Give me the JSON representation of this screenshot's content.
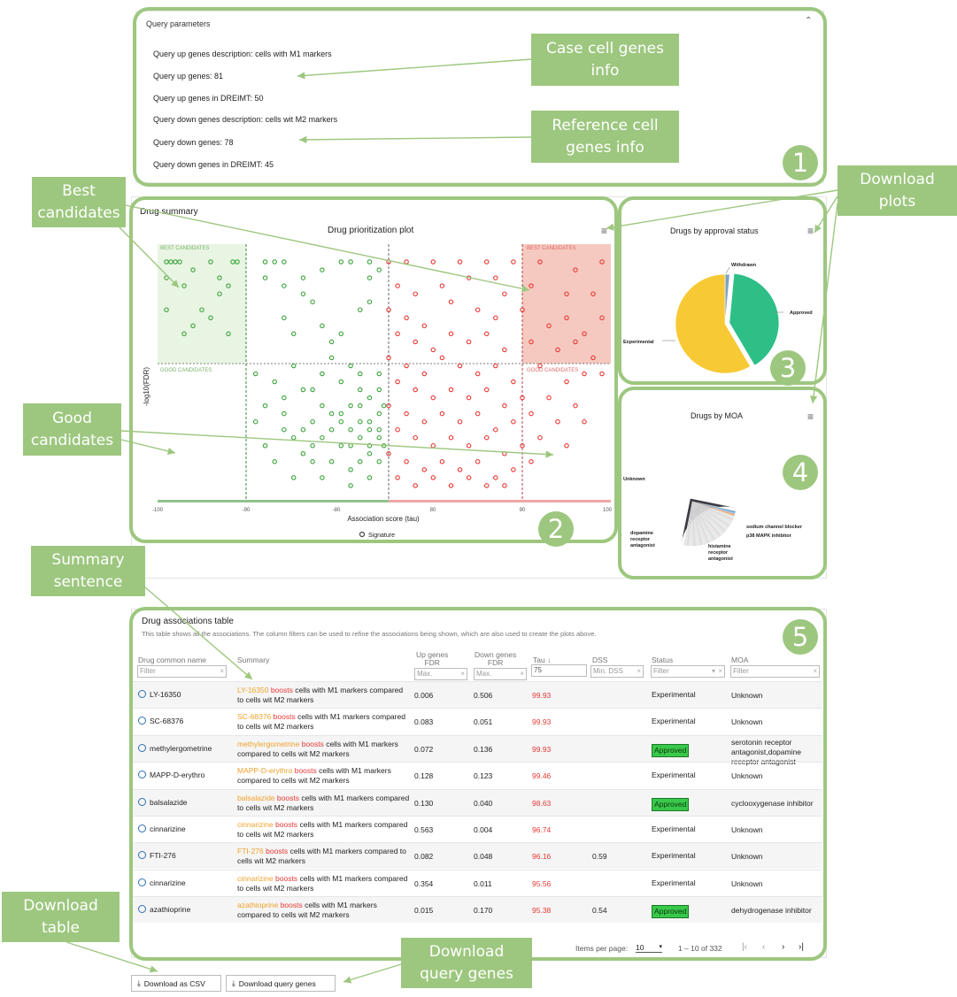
{
  "query_params": {
    "title": "Query parameters",
    "lines": [
      "Query up genes description: cells with M1 markers",
      "Query up genes: 81",
      "Query up genes in DREIMT: 50",
      "Query down genes description: cells wit M2 markers",
      "Query down genes: 78",
      "Query down genes in DREIMT: 45"
    ]
  },
  "callouts": {
    "case": "Case cell genes\ninfo",
    "reference": "Reference  cell\ngenes info",
    "best": "Best\ncandidates",
    "good": "Good\ncandidates",
    "download_plots": "Download\nplots",
    "summary": "Summary\nsentence",
    "download_table": "Download\ntable",
    "download_query": "Download\nquery genes"
  },
  "badges": [
    "1",
    "2",
    "3",
    "4",
    "5"
  ],
  "drug_summary": {
    "section_title": "Drug summary",
    "plot_title": "Drug prioritization plot",
    "best_label": "BEST CANDIDATES",
    "good_label": "GOOD CANDIDATES",
    "y_label": "-log10(FDR)",
    "x_label": "Association score (tau)",
    "x_ticks": [
      "-100",
      "-90",
      "-80",
      "80",
      "90",
      "100"
    ],
    "legend": "Signature"
  },
  "chart_data": [
    {
      "type": "scatter",
      "title": "Drug prioritization plot",
      "xlabel": "Association score (tau)",
      "ylabel": "-log10(FDR)",
      "legend": "Signature",
      "series": [
        {
          "name": "Signature",
          "color": "#3aa33a",
          "points": [
            [
              -99,
              30
            ],
            [
              -98.5,
              30
            ],
            [
              -98,
              30
            ],
            [
              -97.5,
              30
            ],
            [
              -96,
              29
            ],
            [
              -99,
              28
            ],
            [
              -97,
              27
            ],
            [
              -94,
              30
            ],
            [
              -93,
              28
            ],
            [
              -91.5,
              30
            ],
            [
              -91,
              30
            ],
            [
              -92,
              27
            ],
            [
              -99,
              24
            ],
            [
              -96,
              22
            ],
            [
              -95,
              24
            ],
            [
              -94,
              23
            ],
            [
              -93,
              26
            ],
            [
              -97,
              21
            ],
            [
              -92,
              21
            ],
            [
              -88,
              30
            ],
            [
              -87,
              30
            ],
            [
              -86,
              30
            ],
            [
              -88,
              28
            ],
            [
              -86,
              27
            ],
            [
              -84,
              28
            ],
            [
              -82,
              29
            ],
            [
              -80,
              30
            ],
            [
              -79,
              30
            ],
            [
              -77,
              30
            ],
            [
              -77,
              28
            ],
            [
              -76,
              29
            ],
            [
              -84,
              26
            ],
            [
              -83,
              25
            ],
            [
              -86,
              23
            ],
            [
              -85,
              21
            ],
            [
              -82,
              22
            ],
            [
              -80,
              21
            ],
            [
              -78,
              24
            ],
            [
              -77,
              25
            ],
            [
              -81,
              18
            ],
            [
              -85,
              17
            ],
            [
              -87,
              15
            ],
            [
              -89,
              16
            ],
            [
              -88,
              12
            ],
            [
              -86,
              11
            ],
            [
              -83,
              10
            ],
            [
              -82,
              12
            ],
            [
              -80,
              11
            ],
            [
              -79,
              9
            ],
            [
              -78,
              12
            ],
            [
              -77,
              10
            ],
            [
              -76,
              11
            ],
            [
              -84,
              9
            ],
            [
              -85,
              8
            ],
            [
              -83,
              7
            ],
            [
              -82,
              8
            ],
            [
              -81,
              9
            ],
            [
              -80,
              7
            ],
            [
              -79,
              7
            ],
            [
              -78,
              8
            ],
            [
              -77,
              7
            ],
            [
              -76,
              8
            ],
            [
              -84,
              6
            ],
            [
              -83,
              5
            ],
            [
              -81,
              5
            ],
            [
              -79,
              4
            ],
            [
              -78,
              5
            ],
            [
              -77,
              6
            ],
            [
              -76,
              5
            ],
            [
              -82,
              3
            ],
            [
              -79,
              2
            ],
            [
              -77,
              3
            ],
            [
              -85,
              3
            ],
            [
              -87,
              5
            ],
            [
              -89,
              10
            ],
            [
              -88,
              7
            ],
            [
              -86,
              13
            ],
            [
              -83,
              14
            ],
            [
              -80,
              15
            ],
            [
              -78,
              14
            ],
            [
              -76,
              16
            ],
            [
              -77,
              13
            ],
            [
              -79,
              12
            ],
            [
              -82,
              16
            ],
            [
              -84,
              14
            ],
            [
              -86,
              9
            ],
            [
              -81,
              11
            ],
            [
              -80,
              10
            ],
            [
              -78,
              10
            ],
            [
              -77,
              9
            ],
            [
              -76,
              9
            ],
            [
              -75.5,
              7
            ],
            [
              -75.5,
              12
            ],
            [
              -76,
              14
            ],
            [
              -78,
              16
            ],
            [
              -79,
              17
            ],
            [
              -81,
              20
            ]
          ]
        },
        {
          "name": "Signature",
          "color": "#e53935",
          "points": [
            [
              75,
              30
            ],
            [
              77,
              30
            ],
            [
              80,
              30
            ],
            [
              83,
              30
            ],
            [
              86,
              30
            ],
            [
              89,
              30
            ],
            [
              92,
              30
            ],
            [
              96,
              29
            ],
            [
              99,
              30
            ],
            [
              76,
              27
            ],
            [
              78,
              26
            ],
            [
              81,
              27
            ],
            [
              84,
              28
            ],
            [
              87,
              28
            ],
            [
              88,
              26
            ],
            [
              91,
              27
            ],
            [
              95,
              26
            ],
            [
              98,
              26
            ],
            [
              75,
              24
            ],
            [
              77,
              23
            ],
            [
              79,
              22
            ],
            [
              82,
              25
            ],
            [
              85,
              24
            ],
            [
              87,
              23
            ],
            [
              90,
              24
            ],
            [
              93,
              22
            ],
            [
              95,
              23
            ],
            [
              97,
              21
            ],
            [
              99,
              23
            ],
            [
              76,
              21
            ],
            [
              78,
              20
            ],
            [
              80,
              19
            ],
            [
              82,
              21
            ],
            [
              84,
              20
            ],
            [
              86,
              21
            ],
            [
              88,
              19
            ],
            [
              91,
              20
            ],
            [
              94,
              19
            ],
            [
              96,
              20
            ],
            [
              98,
              18
            ],
            [
              75,
              18
            ],
            [
              77,
              17
            ],
            [
              79,
              16
            ],
            [
              81,
              18
            ],
            [
              83,
              17
            ],
            [
              85,
              16
            ],
            [
              87,
              17
            ],
            [
              89,
              15
            ],
            [
              92,
              17
            ],
            [
              95,
              15
            ],
            [
              97,
              16
            ],
            [
              99,
              16
            ],
            [
              76,
              15
            ],
            [
              78,
              14
            ],
            [
              80,
              13
            ],
            [
              82,
              14
            ],
            [
              84,
              13
            ],
            [
              86,
              14
            ],
            [
              88,
              12
            ],
            [
              90,
              13
            ],
            [
              93,
              13
            ],
            [
              96,
              12
            ],
            [
              75,
              12
            ],
            [
              77,
              11
            ],
            [
              79,
              10
            ],
            [
              81,
              11
            ],
            [
              83,
              10
            ],
            [
              85,
              11
            ],
            [
              87,
              9
            ],
            [
              89,
              10
            ],
            [
              91,
              11
            ],
            [
              94,
              10
            ],
            [
              97,
              10
            ],
            [
              76,
              9
            ],
            [
              78,
              8
            ],
            [
              80,
              7
            ],
            [
              82,
              8
            ],
            [
              84,
              7
            ],
            [
              86,
              8
            ],
            [
              88,
              6
            ],
            [
              90,
              7
            ],
            [
              92,
              8
            ],
            [
              95,
              7
            ],
            [
              75,
              6
            ],
            [
              77,
              5
            ],
            [
              79,
              4
            ],
            [
              81,
              5
            ],
            [
              83,
              4
            ],
            [
              85,
              5
            ],
            [
              87,
              3
            ],
            [
              89,
              4
            ],
            [
              91,
              5
            ],
            [
              76,
              3
            ],
            [
              78,
              2
            ],
            [
              80,
              3
            ],
            [
              82,
              2
            ],
            [
              84,
              3
            ],
            [
              86,
              2
            ],
            [
              88,
              2
            ]
          ]
        }
      ],
      "xlim": [
        -100,
        100
      ],
      "ylim": [
        0,
        31
      ],
      "regions": {
        "best": "BEST CANDIDATES",
        "good": "GOOD CANDIDATES"
      }
    },
    {
      "type": "pie",
      "title": "Drugs by approval status",
      "labels": [
        "Withdrawn",
        "Approved",
        "Experimental"
      ],
      "values": [
        1.5,
        40,
        58.5
      ],
      "colors": [
        "#7ea3c8",
        "#2dbf86",
        "#f7c934"
      ]
    },
    {
      "type": "pie",
      "title": "Drugs by MOA",
      "labels": [
        "Unknown",
        "sodium channel blocker",
        "p38 MAPK inhibitor",
        "histamine receptor antagonist",
        "dopamine receptor antagonist"
      ],
      "values": [
        30,
        1,
        1,
        2,
        2
      ],
      "colors": [
        "#3c3c44",
        "#f0a2b3",
        "#e8a848",
        "#3e8ed0",
        "#7cc6e8"
      ]
    }
  ],
  "approval_plot": {
    "title": "Drugs by approval status",
    "labels": {
      "withdrawn": "Withdrawn",
      "approved": "Approved",
      "experimental": "Experimental"
    }
  },
  "moa_plot": {
    "title": "Drugs by MOA",
    "labels": {
      "unknown": "Unknown",
      "sodium": "sodium channel blocker",
      "p38": "p38 MAPK inhibitor",
      "dopamine": "dopamine\nreceptor\nantagonist",
      "histamine": "histamine\nreceptor\nantagonist"
    }
  },
  "table": {
    "title": "Drug associations table",
    "description": "This table shows all the associations. The column filters can be used to refine the associations being shown, which are also used to create the plots above.",
    "headers": {
      "drug": "Drug common name",
      "summary": "Summary",
      "up": "Up genes\nFDR",
      "down": "Down genes\nFDR",
      "tau": "Tau ↓",
      "dss": "DSS",
      "status": "Status",
      "moa": "MOA"
    },
    "filters": {
      "drug": "Filter",
      "up": "Max.",
      "down": "Max.",
      "tau": "75",
      "dss": "Min. DSS",
      "status": "Filter",
      "moa": "Filter"
    },
    "rows": [
      {
        "drug": "LY-16350",
        "name_part": "LY-16350",
        "boosts": "boosts",
        "rest": "cells with M1 markers compared to cells wit M2 markers",
        "up": "0.006",
        "down": "0.506",
        "tau": "99.93",
        "dss": "",
        "status": "Experimental",
        "approved": false,
        "moa": "Unknown"
      },
      {
        "drug": "SC-68376",
        "name_part": "SC-68376",
        "boosts": "boosts",
        "rest": "cells with M1 markers compared to cells wit M2 markers",
        "up": "0.083",
        "down": "0.051",
        "tau": "99.93",
        "dss": "",
        "status": "Experimental",
        "approved": false,
        "moa": "Unknown"
      },
      {
        "drug": "methylergometrine",
        "name_part": "methylergometrine",
        "boosts": "boosts",
        "rest": "cells with M1 markers compared to cells wit M2 markers",
        "up": "0.072",
        "down": "0.136",
        "tau": "99.93",
        "dss": "",
        "status": "Approved",
        "approved": true,
        "moa": "serotonin receptor antagonist,dopamine receptor antagonist"
      },
      {
        "drug": "MAPP-D-erythro",
        "name_part": "MAPP-D-erythro",
        "boosts": "boosts",
        "rest": "cells with M1 markers compared to cells wit M2 markers",
        "up": "0.128",
        "down": "0.123",
        "tau": "99.46",
        "dss": "",
        "status": "Experimental",
        "approved": false,
        "moa": "Unknown"
      },
      {
        "drug": "balsalazide",
        "name_part": "balsalazide",
        "boosts": "boosts",
        "rest": "cells with M1 markers compared to cells wit M2 markers",
        "up": "0.130",
        "down": "0.040",
        "tau": "98.63",
        "dss": "",
        "status": "Approved",
        "approved": true,
        "moa": "cyclooxygenase inhibitor"
      },
      {
        "drug": "cinnarizine",
        "name_part": "cinnarizine",
        "boosts": "boosts",
        "rest": "cells with M1 markers compared to cells wit M2 markers",
        "up": "0.563",
        "down": "0.004",
        "tau": "96.74",
        "dss": "",
        "status": "Experimental",
        "approved": false,
        "moa": "Unknown"
      },
      {
        "drug": "FTI-276",
        "name_part": "FTI-276",
        "boosts": "boosts",
        "rest": "cells with M1 markers compared to cells wit M2 markers",
        "up": "0.082",
        "down": "0.048",
        "tau": "96.16",
        "dss": "0.59",
        "status": "Experimental",
        "approved": false,
        "moa": "Unknown"
      },
      {
        "drug": "cinnarizine",
        "name_part": "cinnarizine",
        "boosts": "boosts",
        "rest": "cells with M1 markers compared to cells wit M2 markers",
        "up": "0.354",
        "down": "0.011",
        "tau": "95.56",
        "dss": "",
        "status": "Experimental",
        "approved": false,
        "moa": "Unknown"
      },
      {
        "drug": "azathioprine",
        "name_part": "azathioprine",
        "boosts": "boosts",
        "rest": "cells with M1 markers compared to cells wit M2 markers",
        "up": "0.015",
        "down": "0.170",
        "tau": "95.38",
        "dss": "0.54",
        "status": "Approved",
        "approved": true,
        "moa": "dehydrogenase inhibitor"
      }
    ],
    "pagination": {
      "label": "Items per page:",
      "per_page": "10",
      "range": "1 – 10 of 332"
    }
  },
  "buttons": {
    "csv": "Download as CSV",
    "query": "Download query genes"
  },
  "colors": {
    "accent_green": "#9dc77f",
    "best_fill": "#e9f5e3",
    "best_red_fill": "#f5c9c0",
    "tau_red": "#e53935",
    "name_orange": "#f0a12a"
  }
}
